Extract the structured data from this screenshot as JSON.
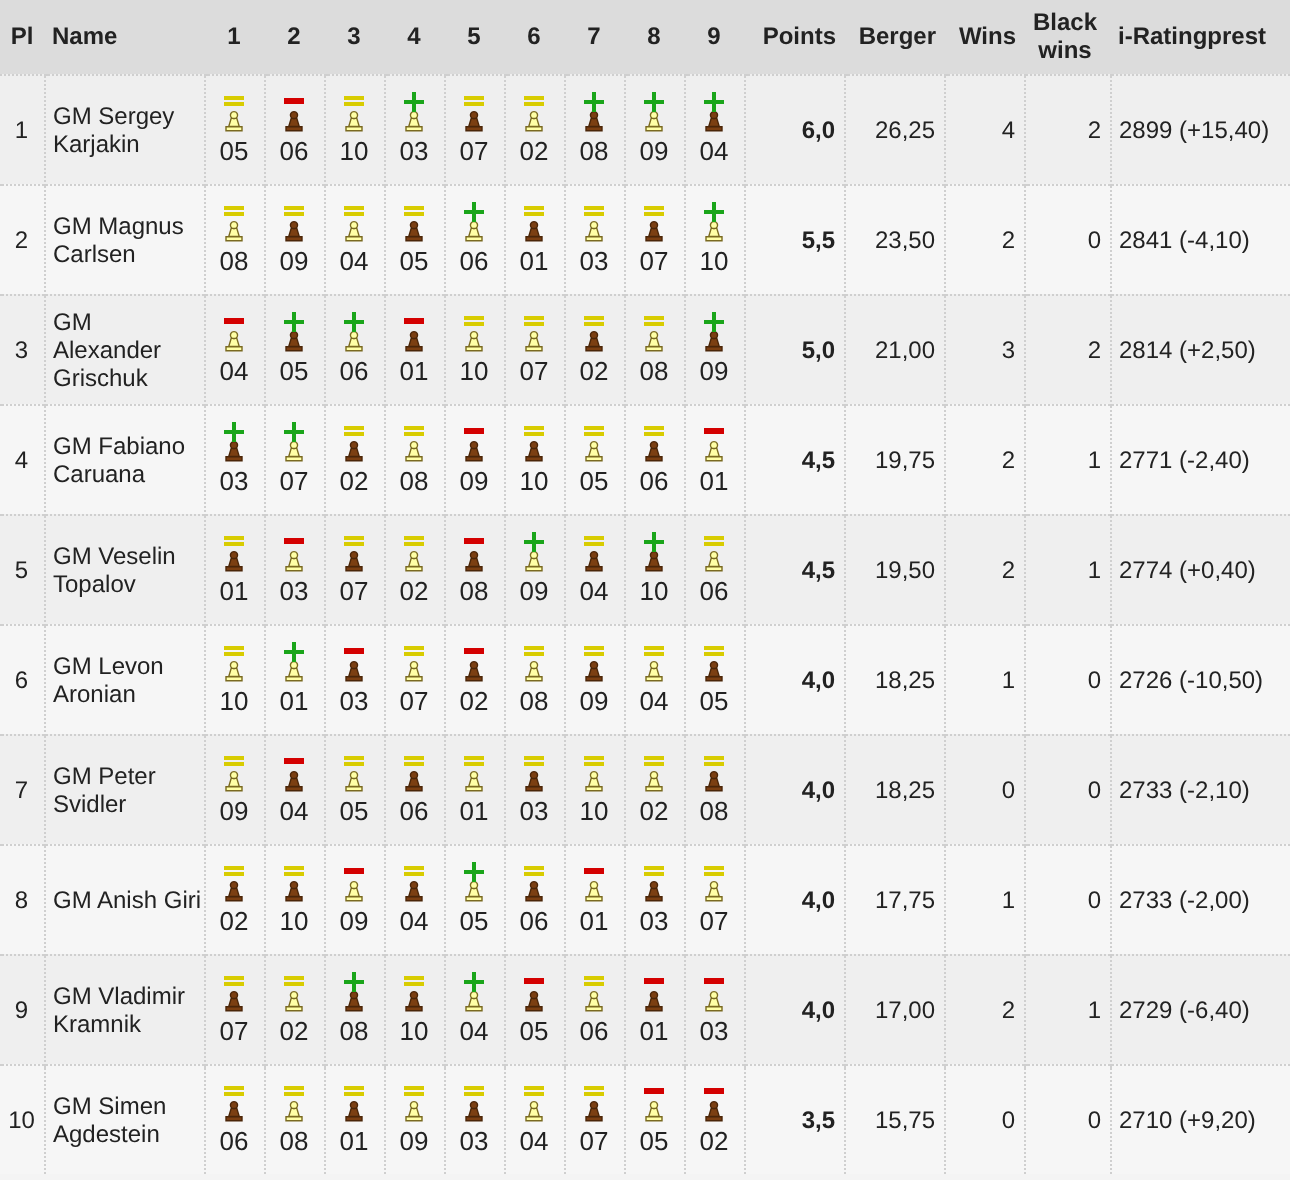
{
  "columns": [
    "Pl",
    "Name",
    "1",
    "2",
    "3",
    "4",
    "5",
    "6",
    "7",
    "8",
    "9",
    "Points",
    "Berger",
    "Wins",
    "Black wins",
    "i-Ratingprest"
  ],
  "rows": [
    {
      "place": "1",
      "name": "GM Sergey Karjakin",
      "games": [
        {
          "kind": "draw",
          "plays_white": true,
          "opponent": "05"
        },
        {
          "kind": "loss",
          "plays_white": false,
          "opponent": "06"
        },
        {
          "kind": "draw",
          "plays_white": true,
          "opponent": "10"
        },
        {
          "kind": "win",
          "plays_white": true,
          "opponent": "03"
        },
        {
          "kind": "draw",
          "plays_white": false,
          "opponent": "07"
        },
        {
          "kind": "draw",
          "plays_white": true,
          "opponent": "02"
        },
        {
          "kind": "win",
          "plays_white": false,
          "opponent": "08"
        },
        {
          "kind": "win",
          "plays_white": true,
          "opponent": "09"
        },
        {
          "kind": "win",
          "plays_white": false,
          "opponent": "04"
        }
      ],
      "points": "6,0",
      "berger": "26,25",
      "wins": "4",
      "black_wins": "2",
      "rating_performance": "2899 (+15,40)"
    },
    {
      "place": "2",
      "name": "GM Magnus Carlsen",
      "games": [
        {
          "kind": "draw",
          "plays_white": true,
          "opponent": "08"
        },
        {
          "kind": "draw",
          "plays_white": false,
          "opponent": "09"
        },
        {
          "kind": "draw",
          "plays_white": true,
          "opponent": "04"
        },
        {
          "kind": "draw",
          "plays_white": false,
          "opponent": "05"
        },
        {
          "kind": "win",
          "plays_white": true,
          "opponent": "06"
        },
        {
          "kind": "draw",
          "plays_white": false,
          "opponent": "01"
        },
        {
          "kind": "draw",
          "plays_white": true,
          "opponent": "03"
        },
        {
          "kind": "draw",
          "plays_white": false,
          "opponent": "07"
        },
        {
          "kind": "win",
          "plays_white": true,
          "opponent": "10"
        }
      ],
      "points": "5,5",
      "berger": "23,50",
      "wins": "2",
      "black_wins": "0",
      "rating_performance": "2841 (-4,10)"
    },
    {
      "place": "3",
      "name": "GM Alexander Grischuk",
      "games": [
        {
          "kind": "loss",
          "plays_white": true,
          "opponent": "04"
        },
        {
          "kind": "win",
          "plays_white": false,
          "opponent": "05"
        },
        {
          "kind": "win",
          "plays_white": true,
          "opponent": "06"
        },
        {
          "kind": "loss",
          "plays_white": false,
          "opponent": "01"
        },
        {
          "kind": "draw",
          "plays_white": true,
          "opponent": "10"
        },
        {
          "kind": "draw",
          "plays_white": true,
          "opponent": "07"
        },
        {
          "kind": "draw",
          "plays_white": false,
          "opponent": "02"
        },
        {
          "kind": "draw",
          "plays_white": true,
          "opponent": "08"
        },
        {
          "kind": "win",
          "plays_white": false,
          "opponent": "09"
        }
      ],
      "points": "5,0",
      "berger": "21,00",
      "wins": "3",
      "black_wins": "2",
      "rating_performance": "2814 (+2,50)"
    },
    {
      "place": "4",
      "name": "GM Fabiano Caruana",
      "games": [
        {
          "kind": "win",
          "plays_white": false,
          "opponent": "03"
        },
        {
          "kind": "win",
          "plays_white": true,
          "opponent": "07"
        },
        {
          "kind": "draw",
          "plays_white": false,
          "opponent": "02"
        },
        {
          "kind": "draw",
          "plays_white": true,
          "opponent": "08"
        },
        {
          "kind": "loss",
          "plays_white": false,
          "opponent": "09"
        },
        {
          "kind": "draw",
          "plays_white": false,
          "opponent": "10"
        },
        {
          "kind": "draw",
          "plays_white": true,
          "opponent": "05"
        },
        {
          "kind": "draw",
          "plays_white": false,
          "opponent": "06"
        },
        {
          "kind": "loss",
          "plays_white": true,
          "opponent": "01"
        }
      ],
      "points": "4,5",
      "berger": "19,75",
      "wins": "2",
      "black_wins": "1",
      "rating_performance": "2771 (-2,40)"
    },
    {
      "place": "5",
      "name": "GM Veselin Topalov",
      "games": [
        {
          "kind": "draw",
          "plays_white": false,
          "opponent": "01"
        },
        {
          "kind": "loss",
          "plays_white": true,
          "opponent": "03"
        },
        {
          "kind": "draw",
          "plays_white": false,
          "opponent": "07"
        },
        {
          "kind": "draw",
          "plays_white": true,
          "opponent": "02"
        },
        {
          "kind": "loss",
          "plays_white": false,
          "opponent": "08"
        },
        {
          "kind": "win",
          "plays_white": true,
          "opponent": "09"
        },
        {
          "kind": "draw",
          "plays_white": false,
          "opponent": "04"
        },
        {
          "kind": "win",
          "plays_white": false,
          "opponent": "10"
        },
        {
          "kind": "draw",
          "plays_white": true,
          "opponent": "06"
        }
      ],
      "points": "4,5",
      "berger": "19,50",
      "wins": "2",
      "black_wins": "1",
      "rating_performance": "2774 (+0,40)"
    },
    {
      "place": "6",
      "name": "GM Levon Aronian",
      "games": [
        {
          "kind": "draw",
          "plays_white": true,
          "opponent": "10"
        },
        {
          "kind": "win",
          "plays_white": true,
          "opponent": "01"
        },
        {
          "kind": "loss",
          "plays_white": false,
          "opponent": "03"
        },
        {
          "kind": "draw",
          "plays_white": true,
          "opponent": "07"
        },
        {
          "kind": "loss",
          "plays_white": false,
          "opponent": "02"
        },
        {
          "kind": "draw",
          "plays_white": true,
          "opponent": "08"
        },
        {
          "kind": "draw",
          "plays_white": false,
          "opponent": "09"
        },
        {
          "kind": "draw",
          "plays_white": true,
          "opponent": "04"
        },
        {
          "kind": "draw",
          "plays_white": false,
          "opponent": "05"
        }
      ],
      "points": "4,0",
      "berger": "18,25",
      "wins": "1",
      "black_wins": "0",
      "rating_performance": "2726 (-10,50)"
    },
    {
      "place": "7",
      "name": "GM Peter Svidler",
      "games": [
        {
          "kind": "draw",
          "plays_white": true,
          "opponent": "09"
        },
        {
          "kind": "loss",
          "plays_white": false,
          "opponent": "04"
        },
        {
          "kind": "draw",
          "plays_white": true,
          "opponent": "05"
        },
        {
          "kind": "draw",
          "plays_white": false,
          "opponent": "06"
        },
        {
          "kind": "draw",
          "plays_white": true,
          "opponent": "01"
        },
        {
          "kind": "draw",
          "plays_white": false,
          "opponent": "03"
        },
        {
          "kind": "draw",
          "plays_white": true,
          "opponent": "10"
        },
        {
          "kind": "draw",
          "plays_white": true,
          "opponent": "02"
        },
        {
          "kind": "draw",
          "plays_white": false,
          "opponent": "08"
        }
      ],
      "points": "4,0",
      "berger": "18,25",
      "wins": "0",
      "black_wins": "0",
      "rating_performance": "2733 (-2,10)"
    },
    {
      "place": "8",
      "name": "GM Anish Giri",
      "games": [
        {
          "kind": "draw",
          "plays_white": false,
          "opponent": "02"
        },
        {
          "kind": "draw",
          "plays_white": false,
          "opponent": "10"
        },
        {
          "kind": "loss",
          "plays_white": true,
          "opponent": "09"
        },
        {
          "kind": "draw",
          "plays_white": false,
          "opponent": "04"
        },
        {
          "kind": "win",
          "plays_white": true,
          "opponent": "05"
        },
        {
          "kind": "draw",
          "plays_white": false,
          "opponent": "06"
        },
        {
          "kind": "loss",
          "plays_white": true,
          "opponent": "01"
        },
        {
          "kind": "draw",
          "plays_white": false,
          "opponent": "03"
        },
        {
          "kind": "draw",
          "plays_white": true,
          "opponent": "07"
        }
      ],
      "points": "4,0",
      "berger": "17,75",
      "wins": "1",
      "black_wins": "0",
      "rating_performance": "2733 (-2,00)"
    },
    {
      "place": "9",
      "name": "GM Vladimir Kramnik",
      "games": [
        {
          "kind": "draw",
          "plays_white": false,
          "opponent": "07"
        },
        {
          "kind": "draw",
          "plays_white": true,
          "opponent": "02"
        },
        {
          "kind": "win",
          "plays_white": false,
          "opponent": "08"
        },
        {
          "kind": "draw",
          "plays_white": false,
          "opponent": "10"
        },
        {
          "kind": "win",
          "plays_white": true,
          "opponent": "04"
        },
        {
          "kind": "loss",
          "plays_white": false,
          "opponent": "05"
        },
        {
          "kind": "draw",
          "plays_white": true,
          "opponent": "06"
        },
        {
          "kind": "loss",
          "plays_white": false,
          "opponent": "01"
        },
        {
          "kind": "loss",
          "plays_white": true,
          "opponent": "03"
        }
      ],
      "points": "4,0",
      "berger": "17,00",
      "wins": "2",
      "black_wins": "1",
      "rating_performance": "2729 (-6,40)"
    },
    {
      "place": "10",
      "name": "GM Simen Agdestein",
      "games": [
        {
          "kind": "draw",
          "plays_white": false,
          "opponent": "06"
        },
        {
          "kind": "draw",
          "plays_white": true,
          "opponent": "08"
        },
        {
          "kind": "draw",
          "plays_white": false,
          "opponent": "01"
        },
        {
          "kind": "draw",
          "plays_white": true,
          "opponent": "09"
        },
        {
          "kind": "draw",
          "plays_white": false,
          "opponent": "03"
        },
        {
          "kind": "draw",
          "plays_white": true,
          "opponent": "04"
        },
        {
          "kind": "draw",
          "plays_white": false,
          "opponent": "07"
        },
        {
          "kind": "loss",
          "plays_white": true,
          "opponent": "05"
        },
        {
          "kind": "loss",
          "plays_white": false,
          "opponent": "02"
        }
      ],
      "points": "3,5",
      "berger": "15,75",
      "wins": "0",
      "black_wins": "0",
      "rating_performance": "2710 (+9,20)"
    }
  ]
}
